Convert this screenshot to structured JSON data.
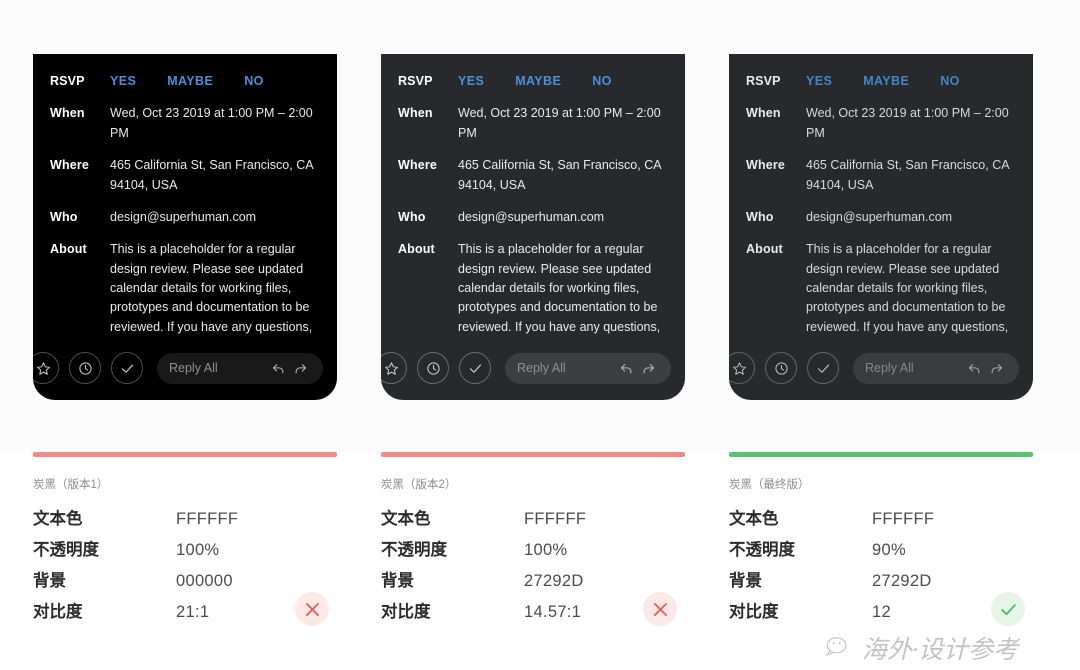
{
  "cards": [
    {
      "id": "card-version-1",
      "background": "#000000",
      "rsvp_label": "RSVP",
      "rsvp_options": [
        "YES",
        "MAYBE",
        "NO"
      ],
      "rows": [
        {
          "label": "When",
          "value": "Wed, Oct 23 2019 at 1:00 PM – 2:00 PM"
        },
        {
          "label": "Where",
          "value": "465 California St, San Francisco, CA 94104, USA"
        },
        {
          "label": "Who",
          "value": "design@superhuman.com"
        },
        {
          "label": "About",
          "value": "This is a placeholder for a regular design review. Please see updated calendar details for working files, prototypes and documentation to be reviewed. If you have any questions,"
        }
      ],
      "footer": {
        "star_icon": "star-icon",
        "clock_icon": "clock-icon",
        "check_icon": "check-icon",
        "reply_placeholder": "Reply All",
        "reply_icon": "reply-arrow-icon",
        "forward_icon": "forward-arrow-icon"
      }
    },
    {
      "id": "card-version-2",
      "background": "#27292D",
      "rsvp_label": "RSVP",
      "rsvp_options": [
        "YES",
        "MAYBE",
        "NO"
      ],
      "rows": [
        {
          "label": "When",
          "value": "Wed, Oct 23 2019 at 1:00 PM – 2:00 PM"
        },
        {
          "label": "Where",
          "value": "465 California St, San Francisco, CA 94104, USA"
        },
        {
          "label": "Who",
          "value": "design@superhuman.com"
        },
        {
          "label": "About",
          "value": "This is a placeholder for a regular design review. Please see updated calendar details for working files, prototypes and documentation to be reviewed. If you have any questions,"
        }
      ],
      "footer": {
        "star_icon": "star-icon",
        "clock_icon": "clock-icon",
        "check_icon": "check-icon",
        "reply_placeholder": "Reply All",
        "reply_icon": "reply-arrow-icon",
        "forward_icon": "forward-arrow-icon"
      }
    },
    {
      "id": "card-final",
      "background": "#27292D",
      "rsvp_label": "RSVP",
      "rsvp_options": [
        "YES",
        "MAYBE",
        "NO"
      ],
      "rows": [
        {
          "label": "When",
          "value": "Wed, Oct 23 2019 at 1:00 PM – 2:00 PM"
        },
        {
          "label": "Where",
          "value": "465 California St, San Francisco, CA 94104, USA"
        },
        {
          "label": "Who",
          "value": "design@superhuman.com"
        },
        {
          "label": "About",
          "value": "This is a placeholder for a regular design review. Please see updated calendar details for working files, prototypes and documentation to be reviewed. If you have any questions,"
        }
      ],
      "footer": {
        "star_icon": "star-icon",
        "clock_icon": "clock-icon",
        "check_icon": "check-icon",
        "reply_placeholder": "Reply All",
        "reply_icon": "reply-arrow-icon",
        "forward_icon": "forward-arrow-icon"
      }
    }
  ],
  "specs": [
    {
      "title": "炭黑（版本1）",
      "accent_color": "#EF8A84",
      "status": "fail",
      "rows": [
        {
          "key": "文本色",
          "value": "FFFFFF"
        },
        {
          "key": "不透明度",
          "value": "100%"
        },
        {
          "key": "背景",
          "value": "000000"
        },
        {
          "key": "对比度",
          "value": "21:1"
        }
      ]
    },
    {
      "title": "炭黑（版本2）",
      "accent_color": "#EF8A84",
      "status": "fail",
      "rows": [
        {
          "key": "文本色",
          "value": "FFFFFF"
        },
        {
          "key": "不透明度",
          "value": "100%"
        },
        {
          "key": "背景",
          "value": "27292D"
        },
        {
          "key": "对比度",
          "value": "14.57:1"
        }
      ]
    },
    {
      "title": "炭黑（最终版）",
      "accent_color": "#5CBF72",
      "status": "pass",
      "rows": [
        {
          "key": "文本色",
          "value": "FFFFFF"
        },
        {
          "key": "不透明度",
          "value": "90%"
        },
        {
          "key": "背景",
          "value": "27292D"
        },
        {
          "key": "对比度",
          "value": "12"
        }
      ]
    }
  ],
  "watermark": {
    "icon": "wechat-icon",
    "text": "海外·设计参考"
  }
}
